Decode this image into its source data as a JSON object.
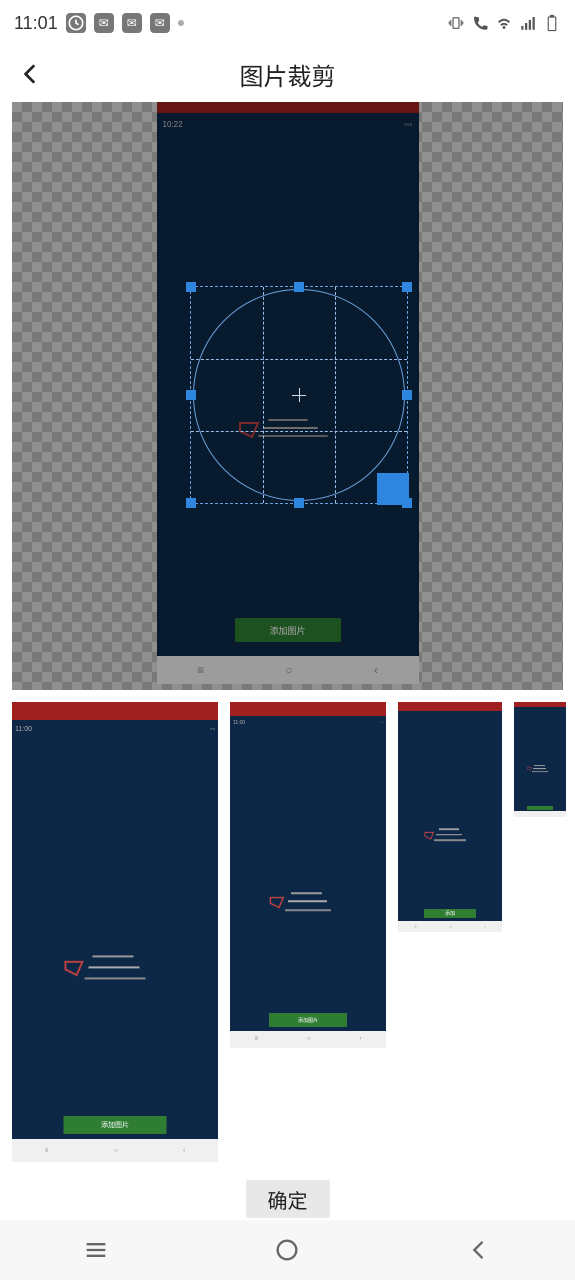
{
  "status_bar": {
    "time": "11:01"
  },
  "header": {
    "title": "图片裁剪"
  },
  "preview": {
    "inner_time": "10:22",
    "inner_top_time": "11:00",
    "add_button": "添加图片"
  },
  "thumbs": {
    "t1_btn": "添加图片",
    "t2_btn": "添加图片",
    "t3_btn": "添加",
    "t4_btn": ""
  },
  "confirm": {
    "label": "确定"
  }
}
